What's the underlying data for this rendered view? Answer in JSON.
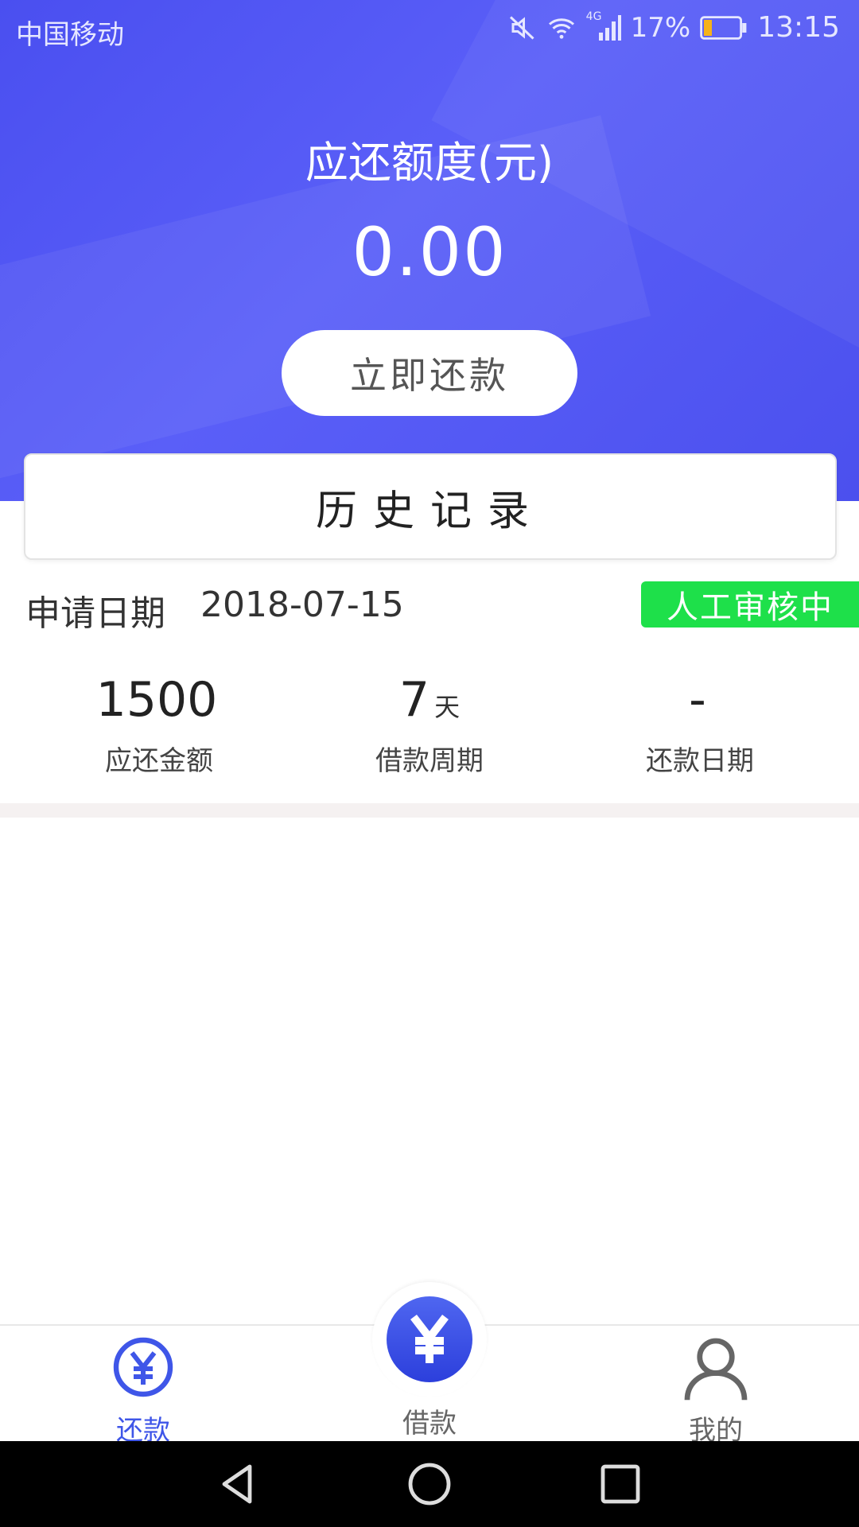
{
  "status_bar": {
    "carrier": "中国移动",
    "network": "4G",
    "battery_percent": "17%",
    "time": "13:15"
  },
  "hero": {
    "title": "应还额度(元)",
    "amount": "0.00",
    "repay_button": "立即还款"
  },
  "history": {
    "title": "历史记录"
  },
  "record": {
    "apply_label": "申请日期",
    "apply_date": "2018-07-15",
    "status": "人工审核中",
    "stats": [
      {
        "value": "1500",
        "unit": "",
        "label": "应还金额"
      },
      {
        "value": "7",
        "unit": "天",
        "label": "借款周期"
      },
      {
        "value": "-",
        "unit": "",
        "label": "还款日期"
      }
    ]
  },
  "tabbar": {
    "tabs": [
      {
        "label": "还款",
        "icon": "yuan-circle-icon",
        "active": true
      },
      {
        "label": "借款",
        "icon": "yuan-filled-icon",
        "active": false
      },
      {
        "label": "我的",
        "icon": "user-icon",
        "active": false
      }
    ]
  },
  "colors": {
    "hero_bg": "#4b50ee",
    "accent": "#3f56e8",
    "status_badge": "#1ee04a"
  }
}
